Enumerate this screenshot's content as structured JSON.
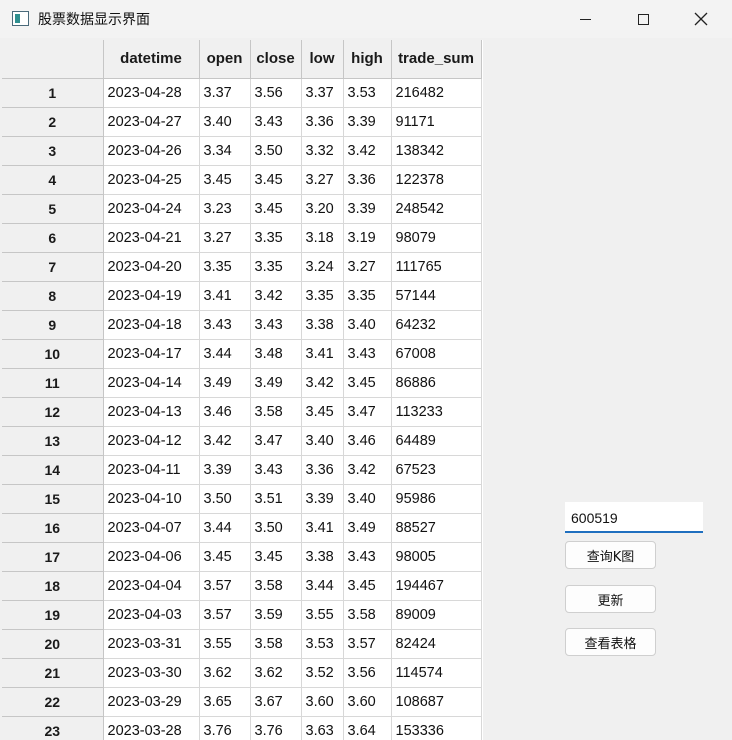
{
  "window": {
    "title": "股票数据显示界面",
    "controls": {
      "minimize": "minimize",
      "maximize": "maximize",
      "close": "✕"
    }
  },
  "table": {
    "columns": [
      "datetime",
      "open",
      "close",
      "low",
      "high",
      "trade_sum"
    ],
    "rows": [
      {
        "index": "1",
        "cells": [
          "2023-04-28",
          "3.37",
          "3.56",
          "3.37",
          "3.53",
          "216482"
        ]
      },
      {
        "index": "2",
        "cells": [
          "2023-04-27",
          "3.40",
          "3.43",
          "3.36",
          "3.39",
          "91171"
        ]
      },
      {
        "index": "3",
        "cells": [
          "2023-04-26",
          "3.34",
          "3.50",
          "3.32",
          "3.42",
          "138342"
        ]
      },
      {
        "index": "4",
        "cells": [
          "2023-04-25",
          "3.45",
          "3.45",
          "3.27",
          "3.36",
          "122378"
        ]
      },
      {
        "index": "5",
        "cells": [
          "2023-04-24",
          "3.23",
          "3.45",
          "3.20",
          "3.39",
          "248542"
        ]
      },
      {
        "index": "6",
        "cells": [
          "2023-04-21",
          "3.27",
          "3.35",
          "3.18",
          "3.19",
          "98079"
        ]
      },
      {
        "index": "7",
        "cells": [
          "2023-04-20",
          "3.35",
          "3.35",
          "3.24",
          "3.27",
          "111765"
        ]
      },
      {
        "index": "8",
        "cells": [
          "2023-04-19",
          "3.41",
          "3.42",
          "3.35",
          "3.35",
          "57144"
        ]
      },
      {
        "index": "9",
        "cells": [
          "2023-04-18",
          "3.43",
          "3.43",
          "3.38",
          "3.40",
          "64232"
        ]
      },
      {
        "index": "10",
        "cells": [
          "2023-04-17",
          "3.44",
          "3.48",
          "3.41",
          "3.43",
          "67008"
        ]
      },
      {
        "index": "11",
        "cells": [
          "2023-04-14",
          "3.49",
          "3.49",
          "3.42",
          "3.45",
          "86886"
        ]
      },
      {
        "index": "12",
        "cells": [
          "2023-04-13",
          "3.46",
          "3.58",
          "3.45",
          "3.47",
          "113233"
        ]
      },
      {
        "index": "13",
        "cells": [
          "2023-04-12",
          "3.42",
          "3.47",
          "3.40",
          "3.46",
          "64489"
        ]
      },
      {
        "index": "14",
        "cells": [
          "2023-04-11",
          "3.39",
          "3.43",
          "3.36",
          "3.42",
          "67523"
        ]
      },
      {
        "index": "15",
        "cells": [
          "2023-04-10",
          "3.50",
          "3.51",
          "3.39",
          "3.40",
          "95986"
        ]
      },
      {
        "index": "16",
        "cells": [
          "2023-04-07",
          "3.44",
          "3.50",
          "3.41",
          "3.49",
          "88527"
        ]
      },
      {
        "index": "17",
        "cells": [
          "2023-04-06",
          "3.45",
          "3.45",
          "3.38",
          "3.43",
          "98005"
        ]
      },
      {
        "index": "18",
        "cells": [
          "2023-04-04",
          "3.57",
          "3.58",
          "3.44",
          "3.45",
          "194467"
        ]
      },
      {
        "index": "19",
        "cells": [
          "2023-04-03",
          "3.57",
          "3.59",
          "3.55",
          "3.58",
          "89009"
        ]
      },
      {
        "index": "20",
        "cells": [
          "2023-03-31",
          "3.55",
          "3.58",
          "3.53",
          "3.57",
          "82424"
        ]
      },
      {
        "index": "21",
        "cells": [
          "2023-03-30",
          "3.62",
          "3.62",
          "3.52",
          "3.56",
          "114574"
        ]
      },
      {
        "index": "22",
        "cells": [
          "2023-03-29",
          "3.65",
          "3.67",
          "3.60",
          "3.60",
          "108687"
        ]
      },
      {
        "index": "23",
        "cells": [
          "2023-03-28",
          "3.76",
          "3.76",
          "3.63",
          "3.64",
          "153336"
        ]
      }
    ]
  },
  "controls": {
    "stock_code_value": "600519",
    "query_kline_label": "查询K图",
    "update_label": "更新",
    "view_table_label": "查看表格"
  },
  "colors": {
    "accent": "#1f6fbf",
    "window_bg": "#f0f0f0",
    "header_bg": "#f0f0f0",
    "cell_bg": "#ffffff"
  }
}
